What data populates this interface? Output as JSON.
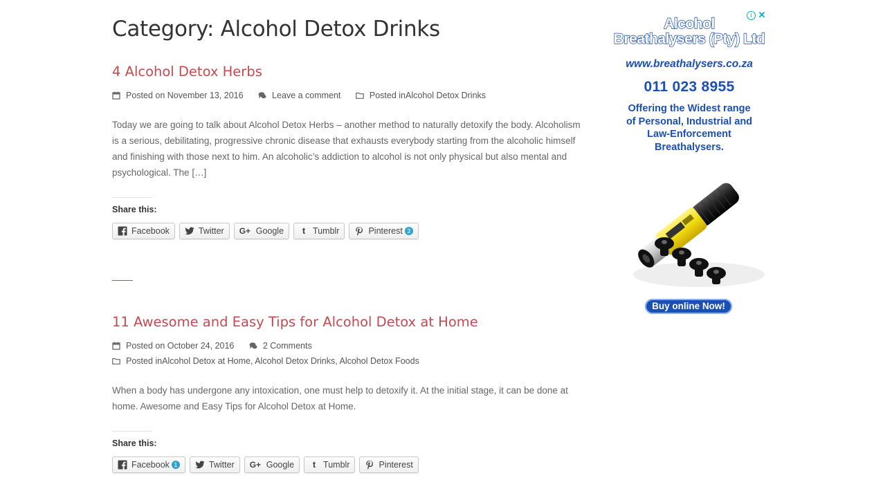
{
  "page": {
    "title": "Category: Alcohol Detox Drinks"
  },
  "posts": [
    {
      "title": "4 Alcohol Detox Herbs",
      "posted_on": "Posted on November 13, 2016",
      "comments": "Leave a comment",
      "posted_in_prefix": "Posted in ",
      "categories": "Alcohol Detox Drinks",
      "excerpt": "Today we are going to talk about Alcohol Detox Herbs – another method to naturally detoxify the body. Alcoholism is a serious, debilitating, progressive chronic disease that exhausts everybody starting from the alcoholic himself and finishing with those next to him. An alcoholic’s addiction to alcohol is not only physical but also mental and psychological. The […]",
      "share_title": "Share this:",
      "share": {
        "facebook": "Facebook",
        "twitter": "Twitter",
        "google": "Google",
        "tumblr": "Tumblr",
        "pinterest": "Pinterest",
        "pinterest_count": "3"
      }
    },
    {
      "title": "11 Awesome and Easy Tips for Alcohol Detox at Home",
      "posted_on": "Posted on October 24, 2016",
      "comments": "2 Comments",
      "posted_in_prefix": "Posted in ",
      "categories": "Alcohol Detox at Home, Alcohol Detox Drinks, Alcohol Detox Foods",
      "excerpt": "When a body has undergone any intoxication, one must help to detoxify it. At the initial stage, it can be done at home. Awesome and Easy Tips for Alcohol Detox at Home.",
      "share_title": "Share this:",
      "share": {
        "facebook": "Facebook",
        "facebook_count": "1",
        "twitter": "Twitter",
        "google": "Google",
        "tumblr": "Tumblr",
        "pinterest": "Pinterest"
      }
    }
  ],
  "ad": {
    "brand_line1": "Alcohol",
    "brand_line2": "Breathalysers (Pty) Ltd",
    "url": "www.breathalysers.co.za",
    "phone": "011 023 8955",
    "offer_line1": "Offering the Widest range",
    "offer_line2": "of Personal, Industrial and",
    "offer_line3": "Law-Enforcement",
    "offer_line4": "Breathalysers.",
    "cta": "Buy online Now!",
    "info_glyph": "i",
    "close_glyph": "✕"
  },
  "colors": {
    "accent": "#c64a4f",
    "ad_blue": "#1a4fb5",
    "count_badge": "#2ea2cc"
  }
}
